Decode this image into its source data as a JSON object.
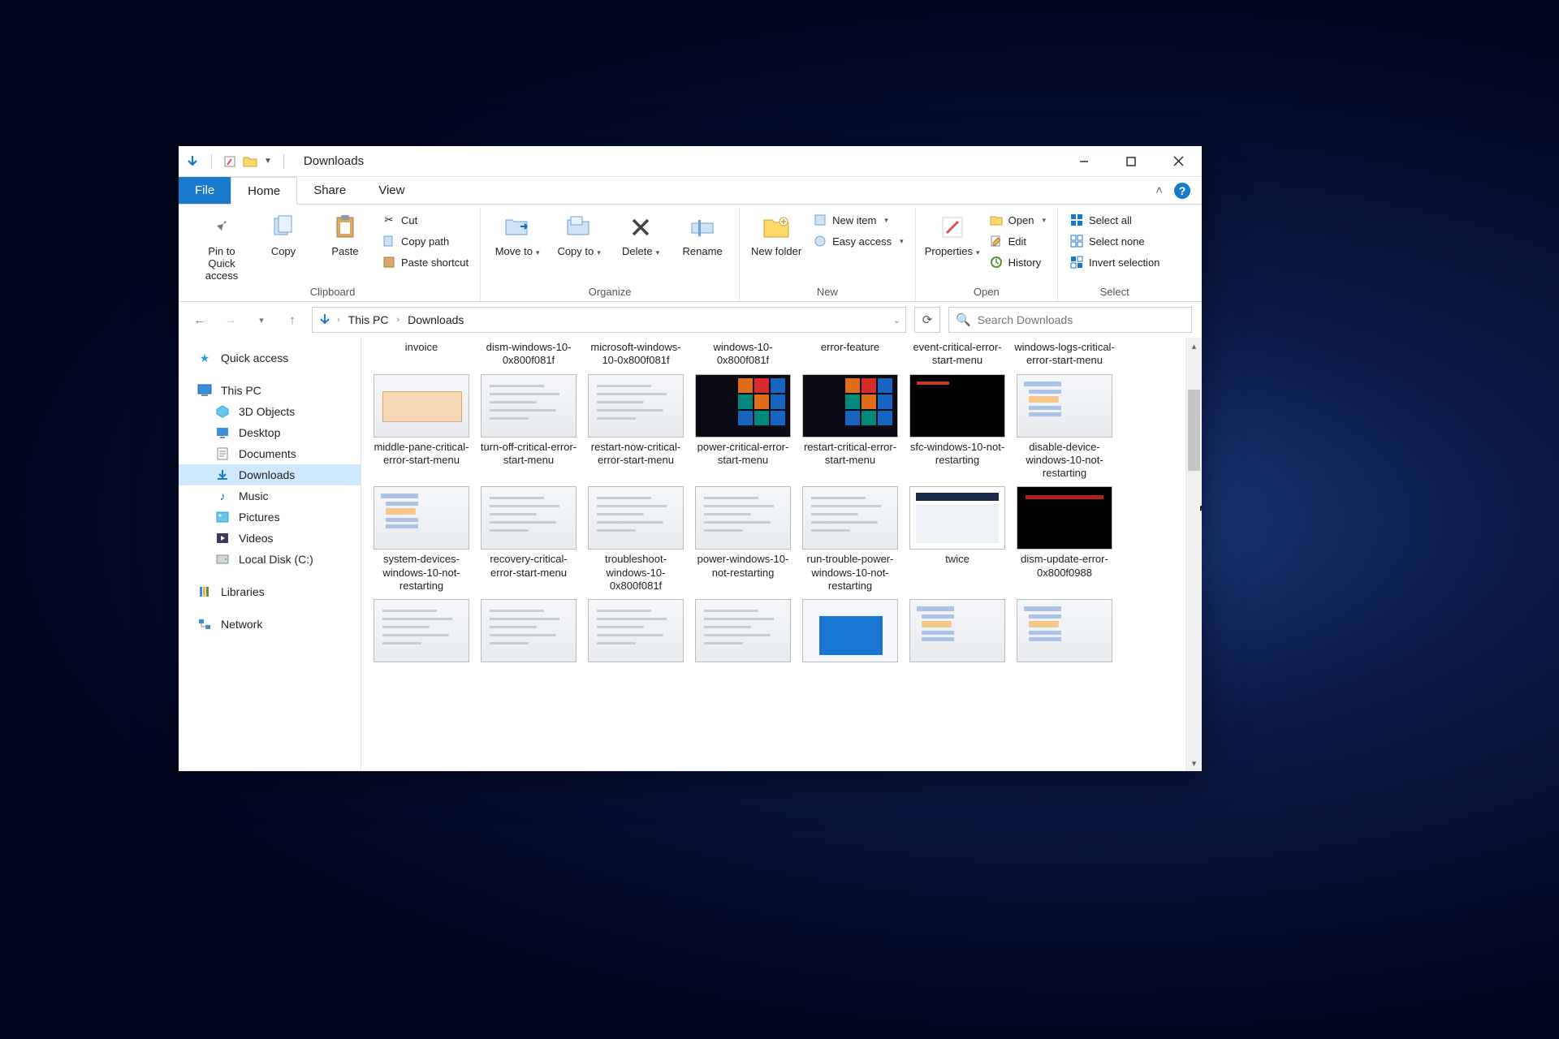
{
  "window": {
    "title": "Downloads"
  },
  "tabs": {
    "file": "File",
    "home": "Home",
    "share": "Share",
    "view": "View"
  },
  "ribbon": {
    "clipboard": {
      "label": "Clipboard",
      "pin": "Pin to Quick access",
      "copy": "Copy",
      "paste": "Paste",
      "cut": "Cut",
      "copypath": "Copy path",
      "pasteshortcut": "Paste shortcut"
    },
    "organize": {
      "label": "Organize",
      "moveto": "Move to",
      "copyto": "Copy to",
      "delete": "Delete",
      "rename": "Rename"
    },
    "new": {
      "label": "New",
      "newfolder": "New folder",
      "newitem": "New item",
      "easyaccess": "Easy access"
    },
    "open": {
      "label": "Open",
      "properties": "Properties",
      "open": "Open",
      "edit": "Edit",
      "history": "History"
    },
    "select": {
      "label": "Select",
      "selectall": "Select all",
      "selectnone": "Select none",
      "invert": "Invert selection"
    }
  },
  "breadcrumb": {
    "root": "This PC",
    "folder": "Downloads"
  },
  "search": {
    "placeholder": "Search Downloads"
  },
  "sidebar": {
    "quick": "Quick access",
    "thispc": "This PC",
    "threed": "3D Objects",
    "desktop": "Desktop",
    "documents": "Documents",
    "downloads": "Downloads",
    "music": "Music",
    "pictures": "Pictures",
    "videos": "Videos",
    "localdisk": "Local Disk (C:)",
    "libraries": "Libraries",
    "network": "Network"
  },
  "row0": [
    "invoice",
    "dism-windows-10-0x800f081f",
    "microsoft-windows-10-0x800f081f",
    "windows-10-0x800f081f",
    "error-feature",
    "event-critical-error-start-menu",
    "windows-logs-critical-error-start-menu"
  ],
  "row1": [
    "middle-pane-critical-error-start-menu",
    "turn-off-critical-error-start-menu",
    "restart-now-critical-error-start-menu",
    "power-critical-error-start-menu",
    "restart-critical-error-start-menu",
    "sfc-windows-10-not-restarting",
    "disable-device-windows-10-not-restarting"
  ],
  "row2": [
    "system-devices-windows-10-not-restarting",
    "recovery-critical-error-start-menu",
    "troubleshoot-windows-10-0x800f081f",
    "power-windows-10-not-restarting",
    "run-trouble-power-windows-10-not-restarting",
    "twice",
    "dism-update-error-0x800f0988"
  ]
}
